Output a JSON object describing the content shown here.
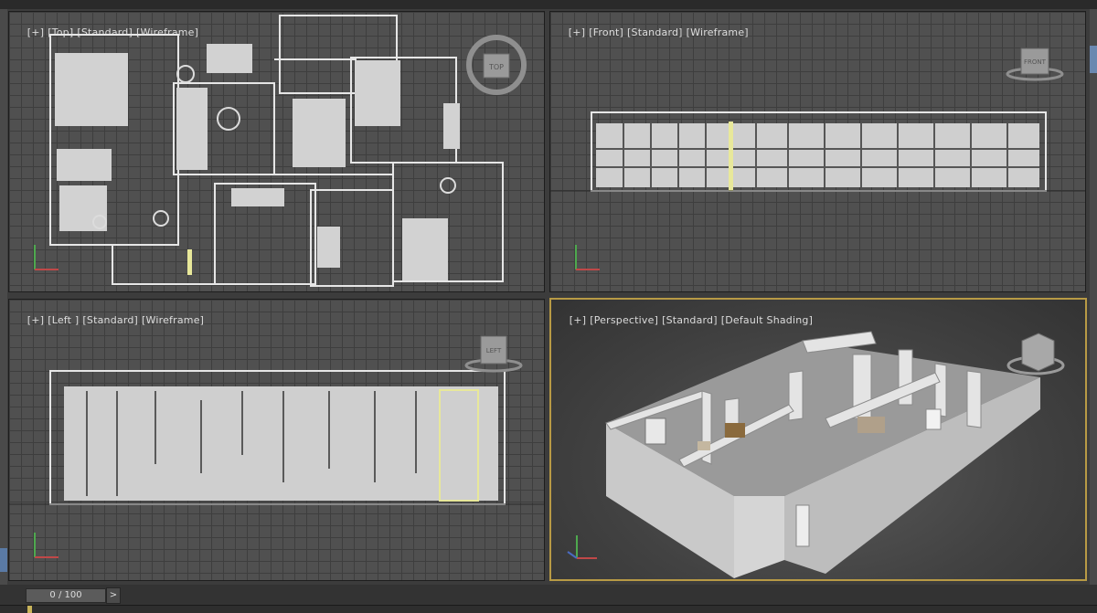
{
  "viewports": {
    "top": {
      "label": [
        "[+]",
        "[Top]",
        "[Standard]",
        "[Wireframe]"
      ],
      "cube_label": "TOP"
    },
    "front": {
      "label": [
        "[+]",
        "[Front]",
        "[Standard]",
        "[Wireframe]"
      ],
      "cube_label": "FRONT"
    },
    "left": {
      "label": [
        "[+]",
        "[Left ]",
        "[Standard]",
        "[Wireframe]"
      ],
      "cube_label": "LEFT"
    },
    "perspective": {
      "label": [
        "[+]",
        "[Perspective]",
        "[Standard]",
        "[Default Shading]"
      ]
    }
  },
  "timeline": {
    "frame": "0 / 100",
    "next_label": ">"
  },
  "colors": {
    "active_border": "#b89a45",
    "selection": "#e8e89a",
    "wire": "#e6e6e6"
  }
}
